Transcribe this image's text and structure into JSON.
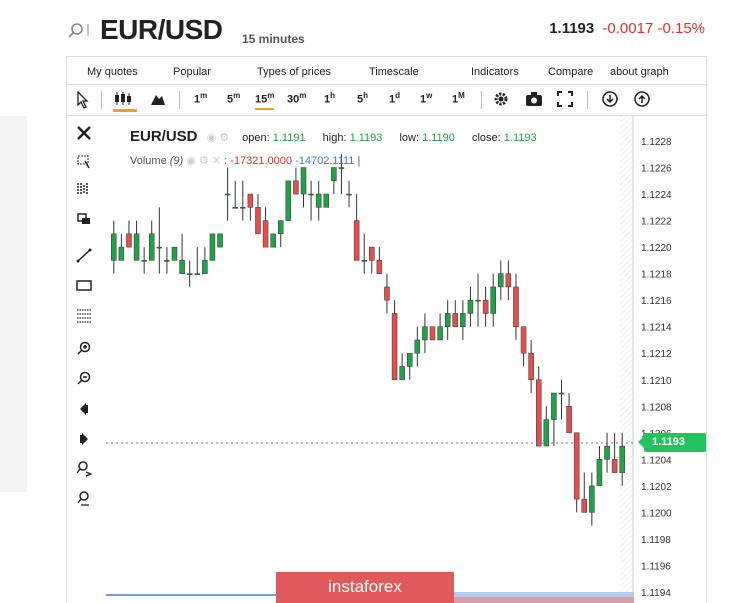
{
  "header": {
    "title": "EUR/USD",
    "interval": "15 minutes",
    "price": "1.1193",
    "change": "-0.0017",
    "change_pct": "-0.15%"
  },
  "menu": [
    "My quotes",
    "Popular",
    "Types of prices",
    "Timescale",
    "Indicators",
    "Compare",
    "about graph"
  ],
  "timeframes": [
    {
      "n": "1",
      "u": "m"
    },
    {
      "n": "5",
      "u": "m"
    },
    {
      "n": "15",
      "u": "m"
    },
    {
      "n": "30",
      "u": "m"
    },
    {
      "n": "1",
      "u": "h"
    },
    {
      "n": "5",
      "u": "h"
    },
    {
      "n": "1",
      "u": "d"
    },
    {
      "n": "1",
      "u": "w"
    },
    {
      "n": "1",
      "u": "M"
    }
  ],
  "legend": {
    "symbol": "EUR/USD",
    "open_label": "open:",
    "open": "1.1191",
    "high_label": "high:",
    "high": "1.1193",
    "low_label": "low:",
    "low": "1.1190",
    "close_label": "close:",
    "close": "1.1193",
    "volume_label": "Volume",
    "volume_period": "(9)",
    "volume_val1": "-17321.0000",
    "volume_val2": "-14702.1111"
  },
  "yaxis": [
    "1.1228",
    "1.1226",
    "1.1224",
    "1.1222",
    "1.1220",
    "1.1218",
    "1.1216",
    "1.1214",
    "1.1212",
    "1.1210",
    "1.1208",
    "1.1206",
    "1.1204",
    "1.1202",
    "1.1200",
    "1.1198",
    "1.1196",
    "1.1194"
  ],
  "current_price_tag": "1.1193",
  "watermark": "instaforex",
  "chart_data": {
    "type": "candlestick",
    "candles": [
      [
        1.1219,
        1.1222,
        1.1218,
        1.1221
      ],
      [
        1.1219,
        1.1221,
        1.1219,
        1.122
      ],
      [
        1.1221,
        1.1222,
        1.122,
        1.122
      ],
      [
        1.1219,
        1.1222,
        1.1219,
        1.1221
      ],
      [
        1.1219,
        1.122,
        1.1218,
        1.1219
      ],
      [
        1.1219,
        1.1222,
        1.1219,
        1.1221
      ],
      [
        1.122,
        1.1223,
        1.1218,
        1.122
      ],
      [
        1.1219,
        1.122,
        1.1218,
        1.1219
      ],
      [
        1.1219,
        1.122,
        1.1219,
        1.122
      ],
      [
        1.1218,
        1.1221,
        1.1218,
        1.1219
      ],
      [
        1.1218,
        1.1219,
        1.1217,
        1.1218
      ],
      [
        1.1218,
        1.122,
        1.1218,
        1.1218
      ],
      [
        1.1218,
        1.122,
        1.1218,
        1.1219
      ],
      [
        1.1219,
        1.1221,
        1.1219,
        1.1221
      ],
      [
        1.122,
        1.1221,
        1.122,
        1.1221
      ],
      [
        1.1224,
        1.1226,
        1.1222,
        1.1224
      ],
      [
        1.1223,
        1.1225,
        1.1223,
        1.1223
      ],
      [
        1.1223,
        1.1225,
        1.1222,
        1.1223
      ],
      [
        1.1224,
        1.1224,
        1.1222,
        1.1223
      ],
      [
        1.1223,
        1.1224,
        1.1221,
        1.1221
      ],
      [
        1.1222,
        1.1223,
        1.122,
        1.122
      ],
      [
        1.122,
        1.1221,
        1.122,
        1.1221
      ],
      [
        1.1221,
        1.1222,
        1.122,
        1.1222
      ],
      [
        1.1222,
        1.1225,
        1.1222,
        1.1225
      ],
      [
        1.1225,
        1.1226,
        1.1224,
        1.1224
      ],
      [
        1.1224,
        1.1226,
        1.1223,
        1.1226
      ],
      [
        1.1224,
        1.1225,
        1.1222,
        1.1224
      ],
      [
        1.1223,
        1.1225,
        1.1222,
        1.1224
      ],
      [
        1.1223,
        1.1224,
        1.1223,
        1.1224
      ],
      [
        1.1225,
        1.1226,
        1.1224,
        1.1226
      ],
      [
        1.1226,
        1.1227,
        1.1224,
        1.1226
      ],
      [
        1.1224,
        1.1225,
        1.1223,
        1.1224
      ],
      [
        1.1222,
        1.1224,
        1.1219,
        1.1219
      ],
      [
        1.1219,
        1.1221,
        1.1218,
        1.1219
      ],
      [
        1.122,
        1.122,
        1.1218,
        1.1219
      ],
      [
        1.1219,
        1.122,
        1.1218,
        1.1218
      ],
      [
        1.1217,
        1.1218,
        1.1215,
        1.1216
      ],
      [
        1.1215,
        1.1216,
        1.121,
        1.121
      ],
      [
        1.121,
        1.1212,
        1.121,
        1.1211
      ],
      [
        1.1211,
        1.1212,
        1.121,
        1.1212
      ],
      [
        1.1212,
        1.1214,
        1.1211,
        1.1213
      ],
      [
        1.1213,
        1.1215,
        1.1212,
        1.1214
      ],
      [
        1.1214,
        1.1214,
        1.1213,
        1.1213
      ],
      [
        1.1213,
        1.1215,
        1.1213,
        1.1214
      ],
      [
        1.1214,
        1.1216,
        1.1213,
        1.1215
      ],
      [
        1.1215,
        1.1216,
        1.1214,
        1.1214
      ],
      [
        1.1214,
        1.1216,
        1.1213,
        1.1215
      ],
      [
        1.1215,
        1.1217,
        1.1214,
        1.1216
      ],
      [
        1.1216,
        1.1218,
        1.1214,
        1.1216
      ],
      [
        1.1216,
        1.1217,
        1.1214,
        1.1215
      ],
      [
        1.1215,
        1.1218,
        1.1214,
        1.1217
      ],
      [
        1.1217,
        1.1219,
        1.1216,
        1.1218
      ],
      [
        1.1218,
        1.1219,
        1.1216,
        1.1217
      ],
      [
        1.1217,
        1.1218,
        1.1213,
        1.1214
      ],
      [
        1.1214,
        1.1214,
        1.1211,
        1.1212
      ],
      [
        1.1212,
        1.1213,
        1.1209,
        1.121
      ],
      [
        1.121,
        1.1211,
        1.1205,
        1.1205
      ],
      [
        1.1205,
        1.1208,
        1.1205,
        1.1207
      ],
      [
        1.1207,
        1.1209,
        1.1205,
        1.1209
      ],
      [
        1.1209,
        1.121,
        1.1207,
        1.1209
      ],
      [
        1.1208,
        1.1209,
        1.1206,
        1.1206
      ],
      [
        1.1206,
        1.1206,
        1.12,
        1.1201
      ],
      [
        1.1201,
        1.1203,
        1.12,
        1.12
      ],
      [
        1.12,
        1.1203,
        1.1199,
        1.1202
      ],
      [
        1.1202,
        1.1205,
        1.1202,
        1.1204
      ],
      [
        1.1204,
        1.1206,
        1.1203,
        1.1205
      ],
      [
        1.1204,
        1.1206,
        1.1203,
        1.1203
      ],
      [
        1.1203,
        1.1206,
        1.1202,
        1.1205
      ]
    ],
    "ylim": [
      1.1193,
      1.1229
    ],
    "current": 1.1193
  }
}
